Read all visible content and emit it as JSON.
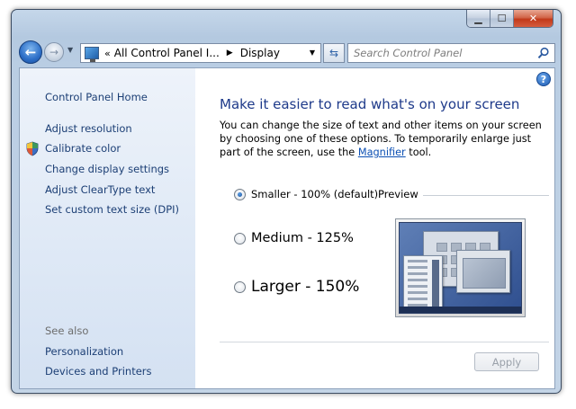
{
  "window": {
    "caption_buttons": {
      "minimize_icon": "minimize-icon",
      "maximize_icon": "maximize-icon",
      "close_icon": "close-icon"
    }
  },
  "nav": {
    "address_prefix": "«",
    "breadcrumbs": [
      "All Control Panel I...",
      "Display"
    ],
    "search_placeholder": "Search Control Panel"
  },
  "sidebar": {
    "home": "Control Panel Home",
    "links": [
      {
        "label": "Adjust resolution",
        "icon": ""
      },
      {
        "label": "Calibrate color",
        "icon": "shield-icon"
      },
      {
        "label": "Change display settings",
        "icon": ""
      },
      {
        "label": "Adjust ClearType text",
        "icon": ""
      },
      {
        "label": "Set custom text size (DPI)",
        "icon": ""
      }
    ],
    "see_also_label": "See also",
    "see_also": [
      "Personalization",
      "Devices and Printers"
    ]
  },
  "main": {
    "title": "Make it easier to read what's on your screen",
    "description_before": "You can change the size of text and other items on your screen by choosing one of these options. To temporarily enlarge just part of the screen, use the ",
    "magnifier_link": "Magnifier",
    "description_after": " tool.",
    "options": [
      {
        "label": "Smaller - 100% (default)",
        "checked": true
      },
      {
        "label": "Medium - 125%",
        "checked": false
      },
      {
        "label": "Larger - 150%",
        "checked": false
      }
    ],
    "preview_label": "Preview",
    "apply_label": "Apply",
    "apply_enabled": false
  },
  "colors": {
    "link": "#1c3f75",
    "title": "#1e3a8a",
    "sidebar_bg": "#dfe9f6"
  }
}
